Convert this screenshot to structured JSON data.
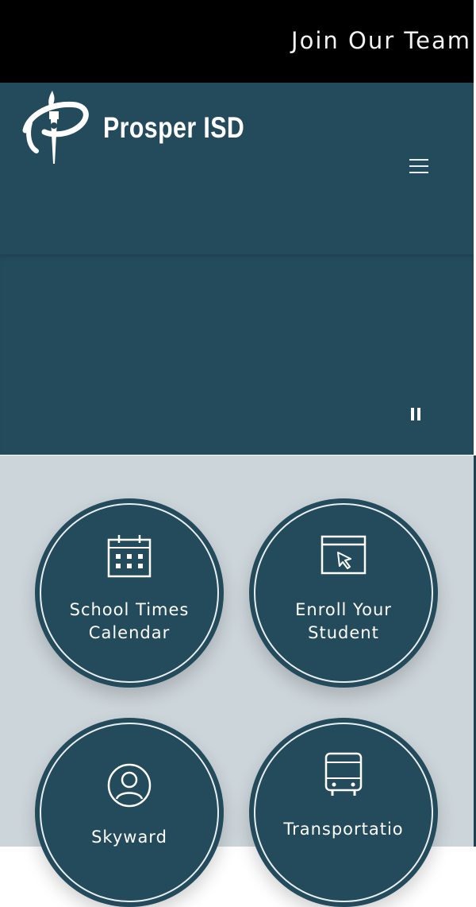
{
  "topbar": {
    "join_label": "Join Our Team"
  },
  "header": {
    "site_name": "Prosper ISD",
    "logo_icon": "prosper-torch-logo",
    "menu_icon": "hamburger-icon"
  },
  "hero": {
    "pause_icon": "pause-icon"
  },
  "quick_links": [
    {
      "line1": "School Times",
      "line2": "Calendar",
      "icon": "calendar-icon"
    },
    {
      "line1": "Enroll Your",
      "line2": "Student",
      "icon": "browser-cursor-icon"
    },
    {
      "line1": "Skyward",
      "line2": "",
      "icon": "user-circle-icon"
    },
    {
      "line1": "Transportatio",
      "line2": "",
      "icon": "bus-icon"
    }
  ],
  "colors": {
    "header_bg": "#234b5c",
    "topbar_bg": "#000000",
    "quicklinks_bg": "#ccd5da"
  }
}
